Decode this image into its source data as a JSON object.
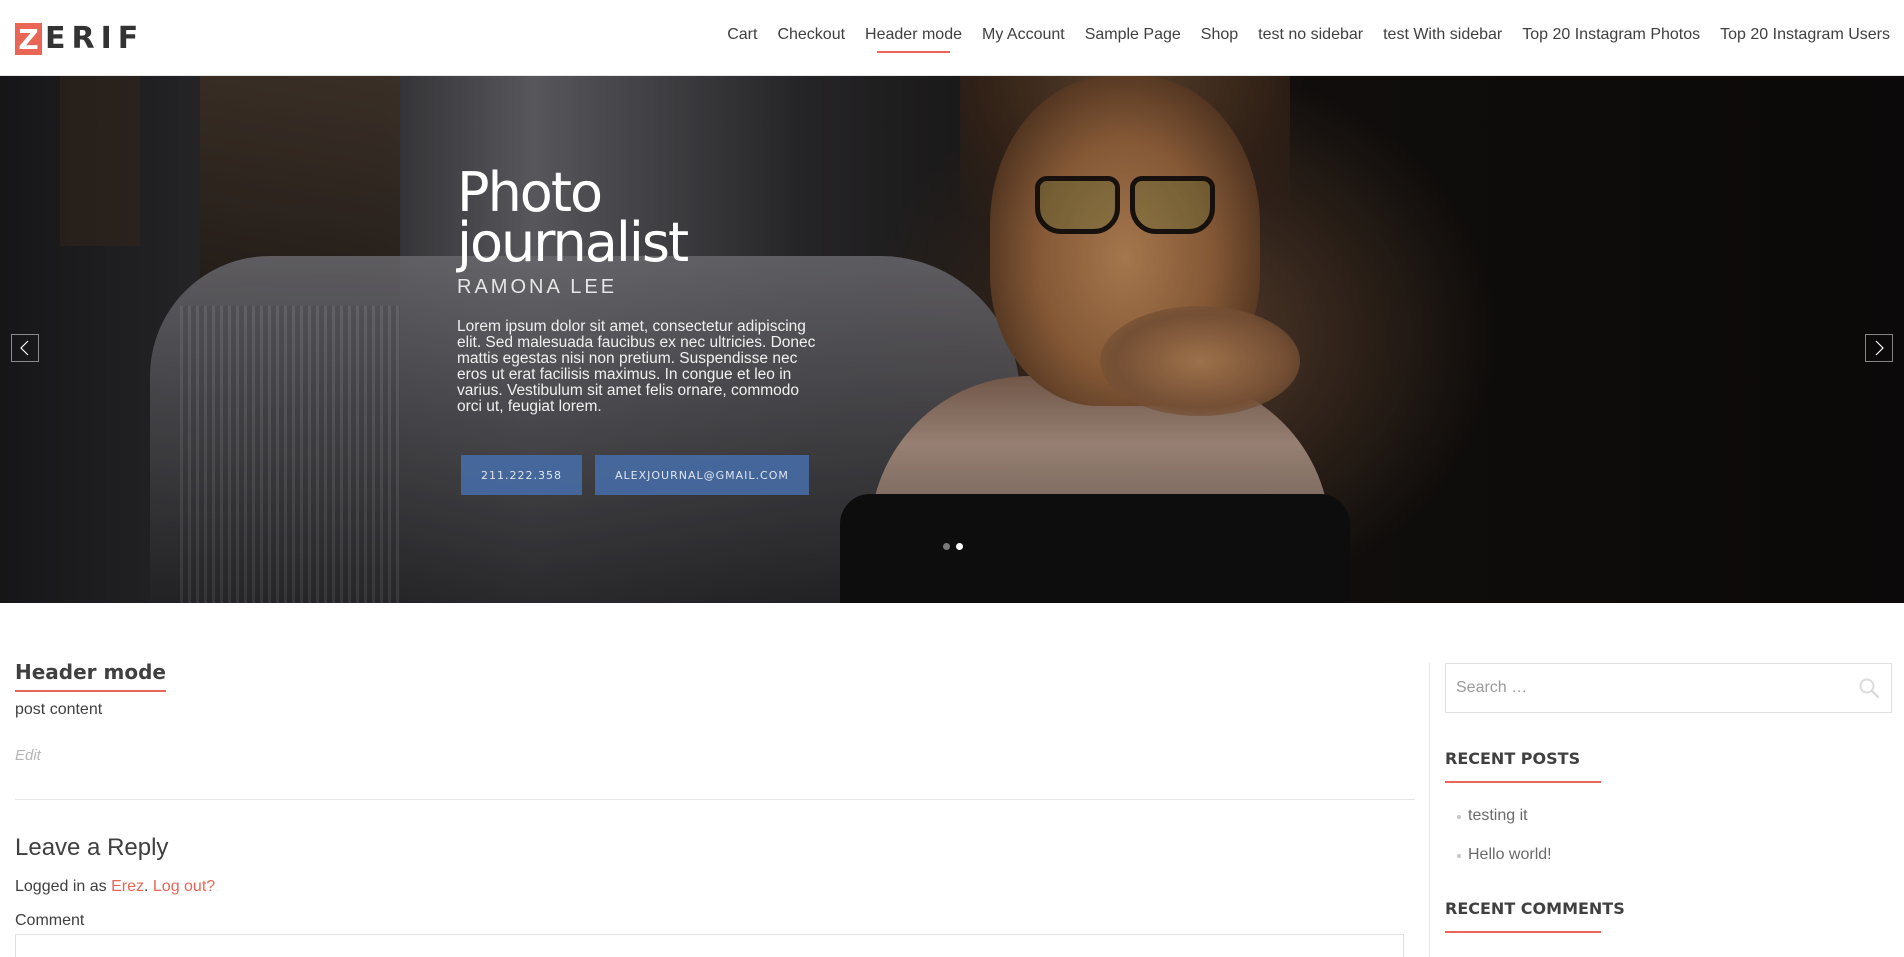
{
  "header": {
    "logo_letter": "Z",
    "logo_rest": "ERIF",
    "nav": [
      {
        "label": "Cart"
      },
      {
        "label": "Checkout"
      },
      {
        "label": "Header mode"
      },
      {
        "label": "My Account"
      },
      {
        "label": "Sample Page"
      },
      {
        "label": "Shop"
      },
      {
        "label": "test no sidebar"
      },
      {
        "label": "test With sidebar"
      },
      {
        "label": "Top 20 Instagram Photos"
      },
      {
        "label": "Top 20 Instagram Users"
      }
    ],
    "active_nav": "Header mode"
  },
  "hero": {
    "title_line1": "Photo",
    "title_line2": "journalist",
    "subtitle": "RAMONA LEE",
    "text": "Lorem ipsum dolor sit amet, consectetur adipiscing elit. Sed malesuada faucibus ex nec ultricies. Donec mattis egestas nisi non pretium. Suspendisse nec eros ut erat facilisis maximus. In congue et leo in varius. Vestibulum sit amet felis ornare, commodo orci ut, feugiat lorem.",
    "phone_button": "211.222.358",
    "email_button": "ALEXJOURNAL@GMAIL.COM",
    "active_slide": 2,
    "slide_count": 2
  },
  "post": {
    "title": "Header mode",
    "content": "post content",
    "edit_label": "Edit"
  },
  "reply": {
    "title": "Leave a Reply",
    "logged_in_prefix": "Logged in as ",
    "user": "Erez",
    "separator": ".",
    "logout": "Log out?",
    "comment_label": "Comment"
  },
  "sidebar": {
    "search_placeholder": "Search …",
    "recent_posts_title": "RECENT POSTS",
    "recent_posts": [
      {
        "label": "testing it"
      },
      {
        "label": "Hello world!"
      }
    ],
    "recent_comments_title": "RECENT COMMENTS"
  },
  "colors": {
    "accent": "#e96656",
    "hero_button": "#466eaa"
  }
}
